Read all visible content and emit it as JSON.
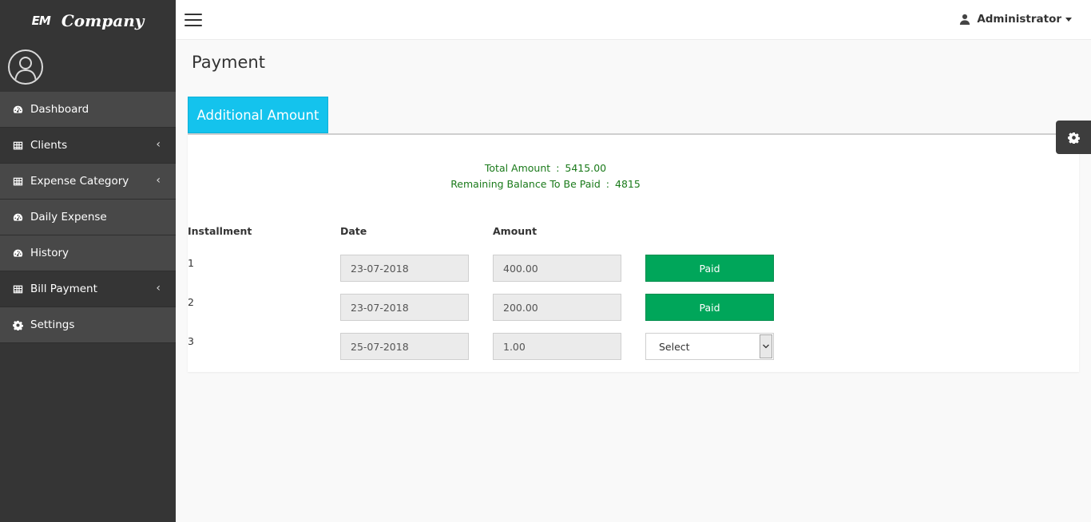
{
  "brand": {
    "logo_text": "EM",
    "name": "Company"
  },
  "sidebar": {
    "items": [
      {
        "label": "Dashboard",
        "icon": "dashboard-icon",
        "has_submenu": false
      },
      {
        "label": "Clients",
        "icon": "table-icon",
        "has_submenu": true
      },
      {
        "label": "Expense Category",
        "icon": "table-icon",
        "has_submenu": true
      },
      {
        "label": "Daily Expense",
        "icon": "dashboard-icon",
        "has_submenu": false
      },
      {
        "label": "History",
        "icon": "dashboard-icon",
        "has_submenu": false
      },
      {
        "label": "Bill Payment",
        "icon": "table-icon",
        "has_submenu": true
      },
      {
        "label": "Settings",
        "icon": "gear-icon",
        "has_submenu": false
      }
    ],
    "chevron": "‹"
  },
  "topbar": {
    "user_label": "Administrator"
  },
  "page": {
    "title": "Payment",
    "tab_label": "Additional Amount"
  },
  "summary": {
    "total_label": "Total Amount",
    "total_value": "5415.00",
    "remaining_label": "Remaining Balance To Be Paid",
    "remaining_value": "4815",
    "separator": ":"
  },
  "table": {
    "headers": [
      "Installment",
      "Date",
      "Amount"
    ],
    "rows": [
      {
        "installment": "1",
        "date": "23-07-2018",
        "amount": "400.00",
        "status": "Paid"
      },
      {
        "installment": "2",
        "date": "23-07-2018",
        "amount": "200.00",
        "status": "Paid"
      },
      {
        "installment": "3",
        "date": "25-07-2018",
        "amount": "1.00",
        "status": "Select"
      }
    ]
  },
  "colors": {
    "accent": "#14c3ed",
    "success": "#00a65a",
    "sidebar": "#353535",
    "total_text": "#1a7a1a"
  }
}
